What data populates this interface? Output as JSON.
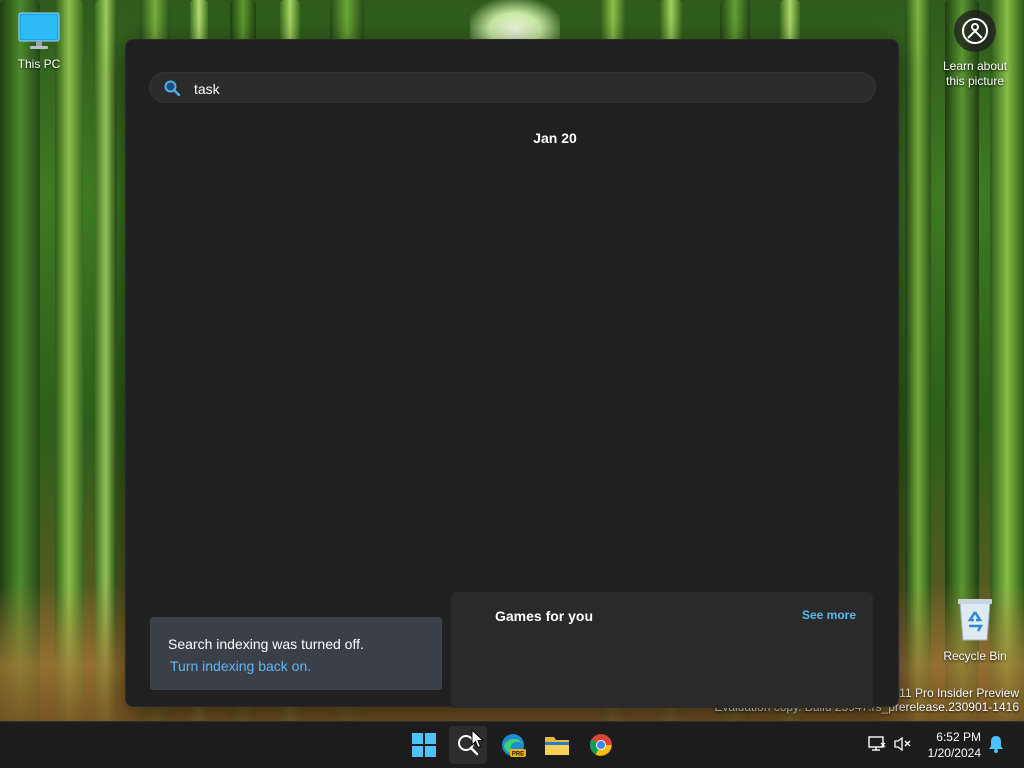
{
  "desktop": {
    "this_pc_label": "This PC",
    "recycle_bin_label": "Recycle Bin",
    "learn_about_label_line1": "Learn about",
    "learn_about_label_line2": "this picture",
    "watermark_line1": "s 11 Pro Insider Preview",
    "watermark_line2": "Evaluation copy. Build 25947.rs_prerelease.230901-1416"
  },
  "search": {
    "query": "task",
    "date_label": "Jan 20",
    "indexing_message": "Search indexing was turned off.",
    "indexing_link": "Turn indexing back on.",
    "games_title": "Games for you",
    "see_more_label": "See more"
  },
  "taskbar": {
    "apps": [
      {
        "name": "start",
        "icon": "windows-logo-icon"
      },
      {
        "name": "search",
        "icon": "search-icon"
      },
      {
        "name": "edge-preview",
        "icon": "edge-icon",
        "badge": "PRE"
      },
      {
        "name": "file-explorer",
        "icon": "folder-icon"
      },
      {
        "name": "chrome",
        "icon": "chrome-icon"
      }
    ],
    "time": "6:52 PM",
    "date": "1/20/2024"
  },
  "colors": {
    "panel_bg": "#202020",
    "accent_link": "#5cb8f0",
    "taskbar_bg": "#1c1c1c"
  }
}
